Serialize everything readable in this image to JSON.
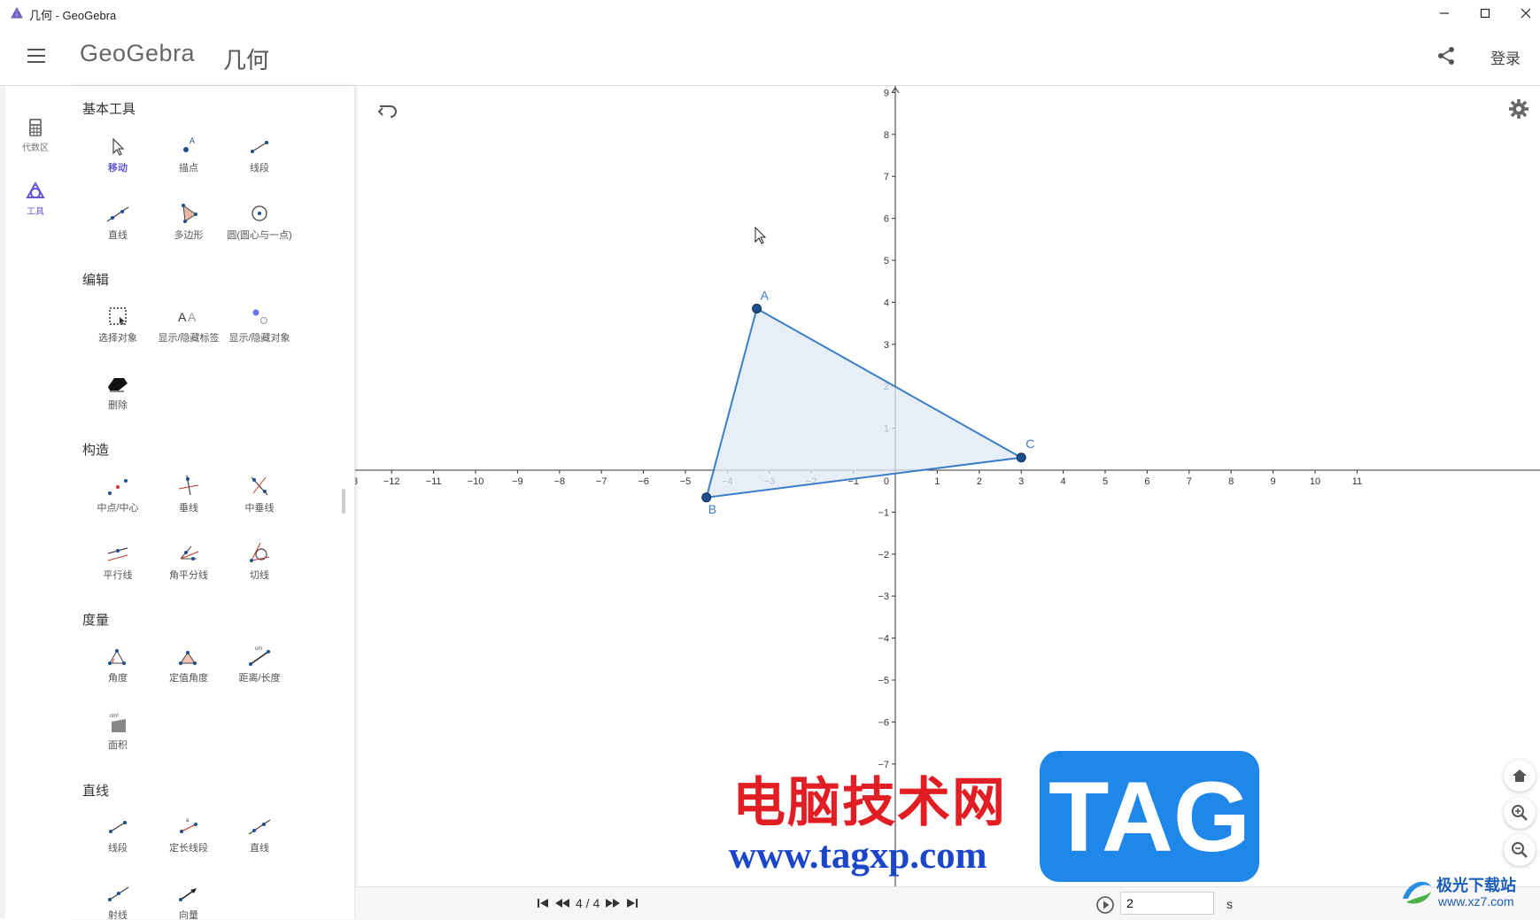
{
  "window": {
    "title": "几何 - GeoGebra",
    "controls": [
      "minimize",
      "maximize",
      "close"
    ]
  },
  "header": {
    "logo": "GeoGebra",
    "app_name": "几何",
    "login_label": "登录"
  },
  "sidebar": {
    "items": [
      {
        "label": "代数区",
        "icon": "calculator-icon",
        "active": false
      },
      {
        "label": "工具",
        "icon": "shapes-icon",
        "active": true
      }
    ]
  },
  "tools": {
    "sections": [
      {
        "title": "基本工具",
        "items": [
          "移动",
          "描点",
          "线段",
          "直线",
          "多边形",
          "圆(圆心与一点)"
        ]
      },
      {
        "title": "编辑",
        "items": [
          "选择对象",
          "显示/隐藏标签",
          "显示/隐藏对象",
          "删除"
        ]
      },
      {
        "title": "构造",
        "items": [
          "中点/中心",
          "垂线",
          "中垂线",
          "平行线",
          "角平分线",
          "切线"
        ]
      },
      {
        "title": "度量",
        "items": [
          "角度",
          "定值角度",
          "距离/长度",
          "面积"
        ]
      },
      {
        "title": "直线",
        "items": [
          "线段",
          "定长线段",
          "直线",
          "射线",
          "向量"
        ]
      }
    ]
  },
  "graphics": {
    "x_range": [
      -13,
      11
    ],
    "y_range": [
      -7,
      9
    ],
    "points": [
      {
        "name": "A",
        "x": -3.3,
        "y": 3.85
      },
      {
        "name": "B",
        "x": -4.5,
        "y": -0.65
      },
      {
        "name": "C",
        "x": 3.0,
        "y": 0.3
      }
    ],
    "colors": {
      "polygon_stroke": "#3a7dc8",
      "polygon_fill": "#dde8f5",
      "point": "#1f4e8c",
      "axis": "#333333",
      "accent": "#6557d2"
    }
  },
  "bottom": {
    "slide_indicator": "4 / 4",
    "speed_value": "2",
    "speed_unit": "s"
  },
  "watermark": {
    "cn_text": "电脑技术网",
    "url_text": "www.tagxp.com",
    "tag_text": "TAG",
    "site_cn": "极光下载站",
    "site_url": "www.xz7.com"
  }
}
